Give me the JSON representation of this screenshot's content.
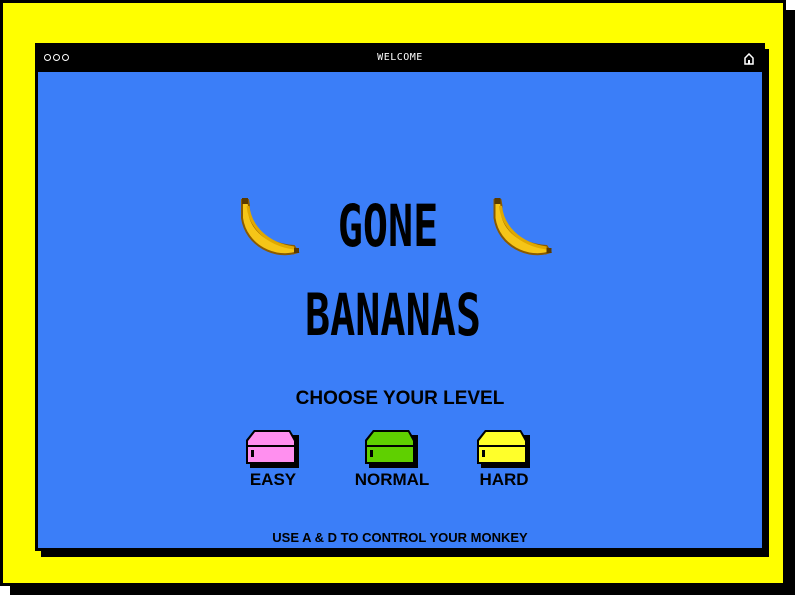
{
  "window": {
    "title": "WELCOME"
  },
  "game": {
    "title_line1": "GONE",
    "title_line2": "BANANAS",
    "choose_label": "CHOOSE YOUR LEVEL",
    "levels": [
      {
        "label": "EASY",
        "color": "#ff8fef"
      },
      {
        "label": "NORMAL",
        "color": "#5fd000"
      },
      {
        "label": "HARD",
        "color": "#ffff2a"
      }
    ],
    "instructions": "USE A & D TO CONTROL YOUR MONKEY"
  },
  "colors": {
    "background": "#ffff00",
    "window": "#3b7ef8",
    "titlebar": "#000000"
  },
  "icons": [
    "window-dot-icon",
    "home-icon",
    "banana-icon",
    "disk-icon"
  ]
}
